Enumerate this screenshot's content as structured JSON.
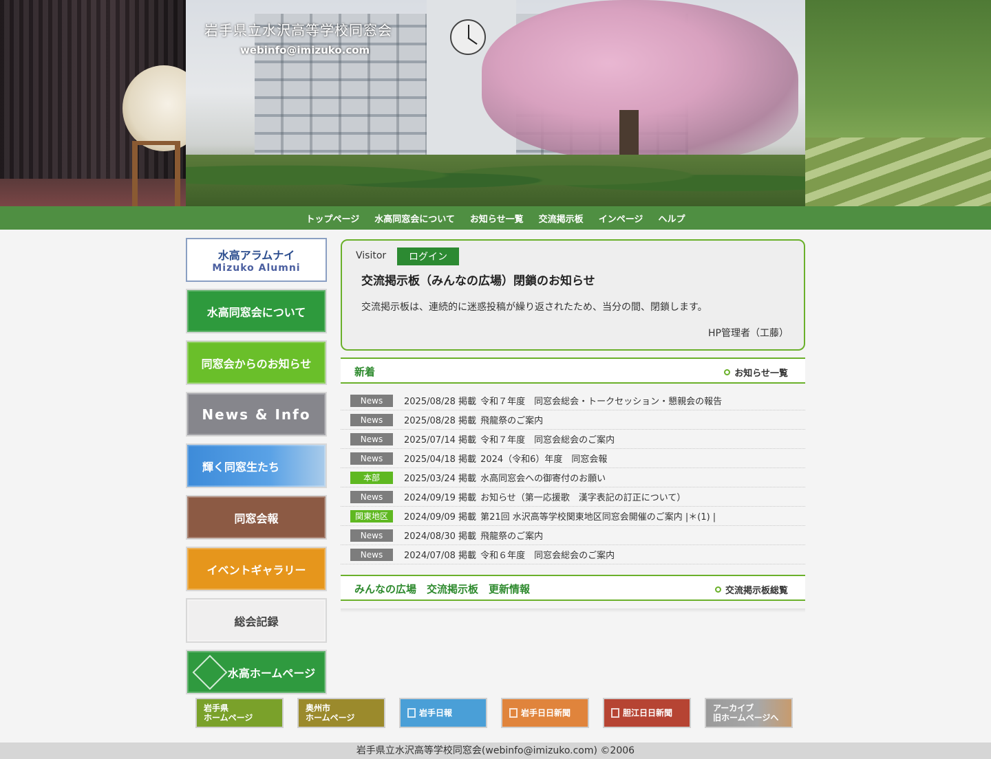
{
  "header": {
    "title": "岩手県立水沢高等学校同窓会",
    "email": "webinfo@imizuko.com"
  },
  "nav": [
    "トップページ",
    "水高同窓会について",
    "お知らせ一覧",
    "交流掲示板",
    "インページ",
    "ヘルプ"
  ],
  "sidebar": {
    "alumni_line1": "水高アラムナイ",
    "alumni_line2": "Mizuko Alumni",
    "about": "水高同窓会について",
    "notices": "同窓会からのお知らせ",
    "news_info": "News & Info",
    "shining": "輝く同窓生たち",
    "bulletin": "同窓会報",
    "events": "イベントギャラリー",
    "records": "総会記録",
    "homepage": "水高ホームページ"
  },
  "notice": {
    "visitor": "Visitor",
    "login": "ログイン",
    "title": "交流掲示板（みんなの広場）閉鎖のお知らせ",
    "body": "交流掲示板は、連続的に迷惑投稿が繰り返されたため、当分の間、閉鎖します。",
    "sign": "HP管理者（工藤）"
  },
  "news_section": {
    "title": "新着",
    "more": "お知らせ一覧",
    "items": [
      {
        "tag": "News",
        "date": "2025/08/28 掲載",
        "text": "令和７年度　同窓会総会・トークセッション・懇親会の報告"
      },
      {
        "tag": "News",
        "date": "2025/08/28 掲載",
        "text": "飛龍祭のご案内"
      },
      {
        "tag": "News",
        "date": "2025/07/14 掲載",
        "text": "令和７年度　同窓会総会のご案内"
      },
      {
        "tag": "News",
        "date": "2025/04/18 掲載",
        "text": "2024（令和6）年度　同窓会報"
      },
      {
        "tag": "本部",
        "date": "2025/03/24 掲載",
        "text": "水高同窓会への御寄付のお願い"
      },
      {
        "tag": "News",
        "date": "2024/09/19 掲載",
        "text": "お知らせ（第一応援歌　漢字表記の訂正について）"
      },
      {
        "tag": "関東地区",
        "date": "2024/09/09 掲載",
        "text": "第21回 水沢高等学校関東地区同窓会開催のご案内 |＊(1) |"
      },
      {
        "tag": "News",
        "date": "2024/08/30 掲載",
        "text": "飛龍祭のご案内"
      },
      {
        "tag": "News",
        "date": "2024/07/08 掲載",
        "text": "令和６年度　同窓会総会のご案内"
      }
    ]
  },
  "board_section": {
    "title": "みんなの広場　交流掲示板　更新情報",
    "more": "交流掲示板総覧"
  },
  "footer_links": {
    "iwate_pref": [
      "岩手県",
      "ホームページ"
    ],
    "oshu_city": [
      "奥州市",
      "ホームページ"
    ],
    "iwate_nippo": "岩手日報",
    "iwate_nichinichi": "岩手日日新聞",
    "tanko_nichinichi": "胆江日日新聞",
    "archive": [
      "アーカイブ",
      "旧ホームページへ"
    ]
  },
  "copyright": "岩手県立水沢高等学校同窓会(webinfo@imizuko.com) ©2006"
}
